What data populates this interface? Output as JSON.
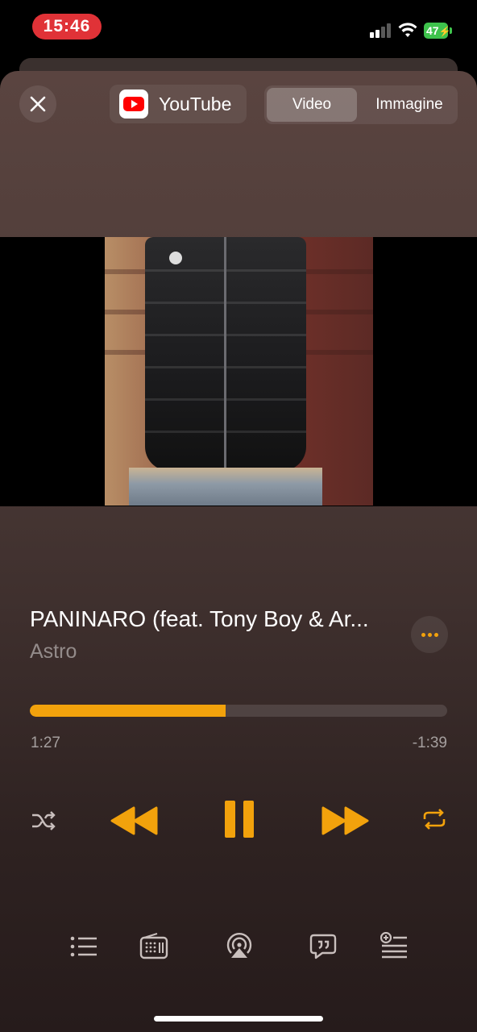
{
  "status_bar": {
    "time": "15:46",
    "battery_percent": "47",
    "icons": [
      "signal-icon",
      "wifi-icon",
      "battery-charging-icon"
    ]
  },
  "header": {
    "close_icon": "close-icon",
    "source_app": "YouTube",
    "segments": [
      {
        "label": "Video",
        "selected": true
      },
      {
        "label": "Immagine",
        "selected": false
      }
    ]
  },
  "track": {
    "title": "PANINARO (feat. Tony Boy & Ar...",
    "artist": "Astro"
  },
  "playback": {
    "elapsed": "1:27",
    "remaining": "-1:39",
    "progress_fraction": 0.47,
    "state": "playing"
  },
  "controls": [
    "shuffle-icon",
    "rewind-icon",
    "pause-icon",
    "fast-forward-icon",
    "repeat-icon"
  ],
  "bottom_bar": [
    "queue-list-icon",
    "radio-icon",
    "airplay-icon",
    "lyrics-icon",
    "add-to-list-icon"
  ],
  "colors": {
    "accent": "#f2a20c",
    "time_pill": "#e03237",
    "battery": "#3ec24c"
  }
}
